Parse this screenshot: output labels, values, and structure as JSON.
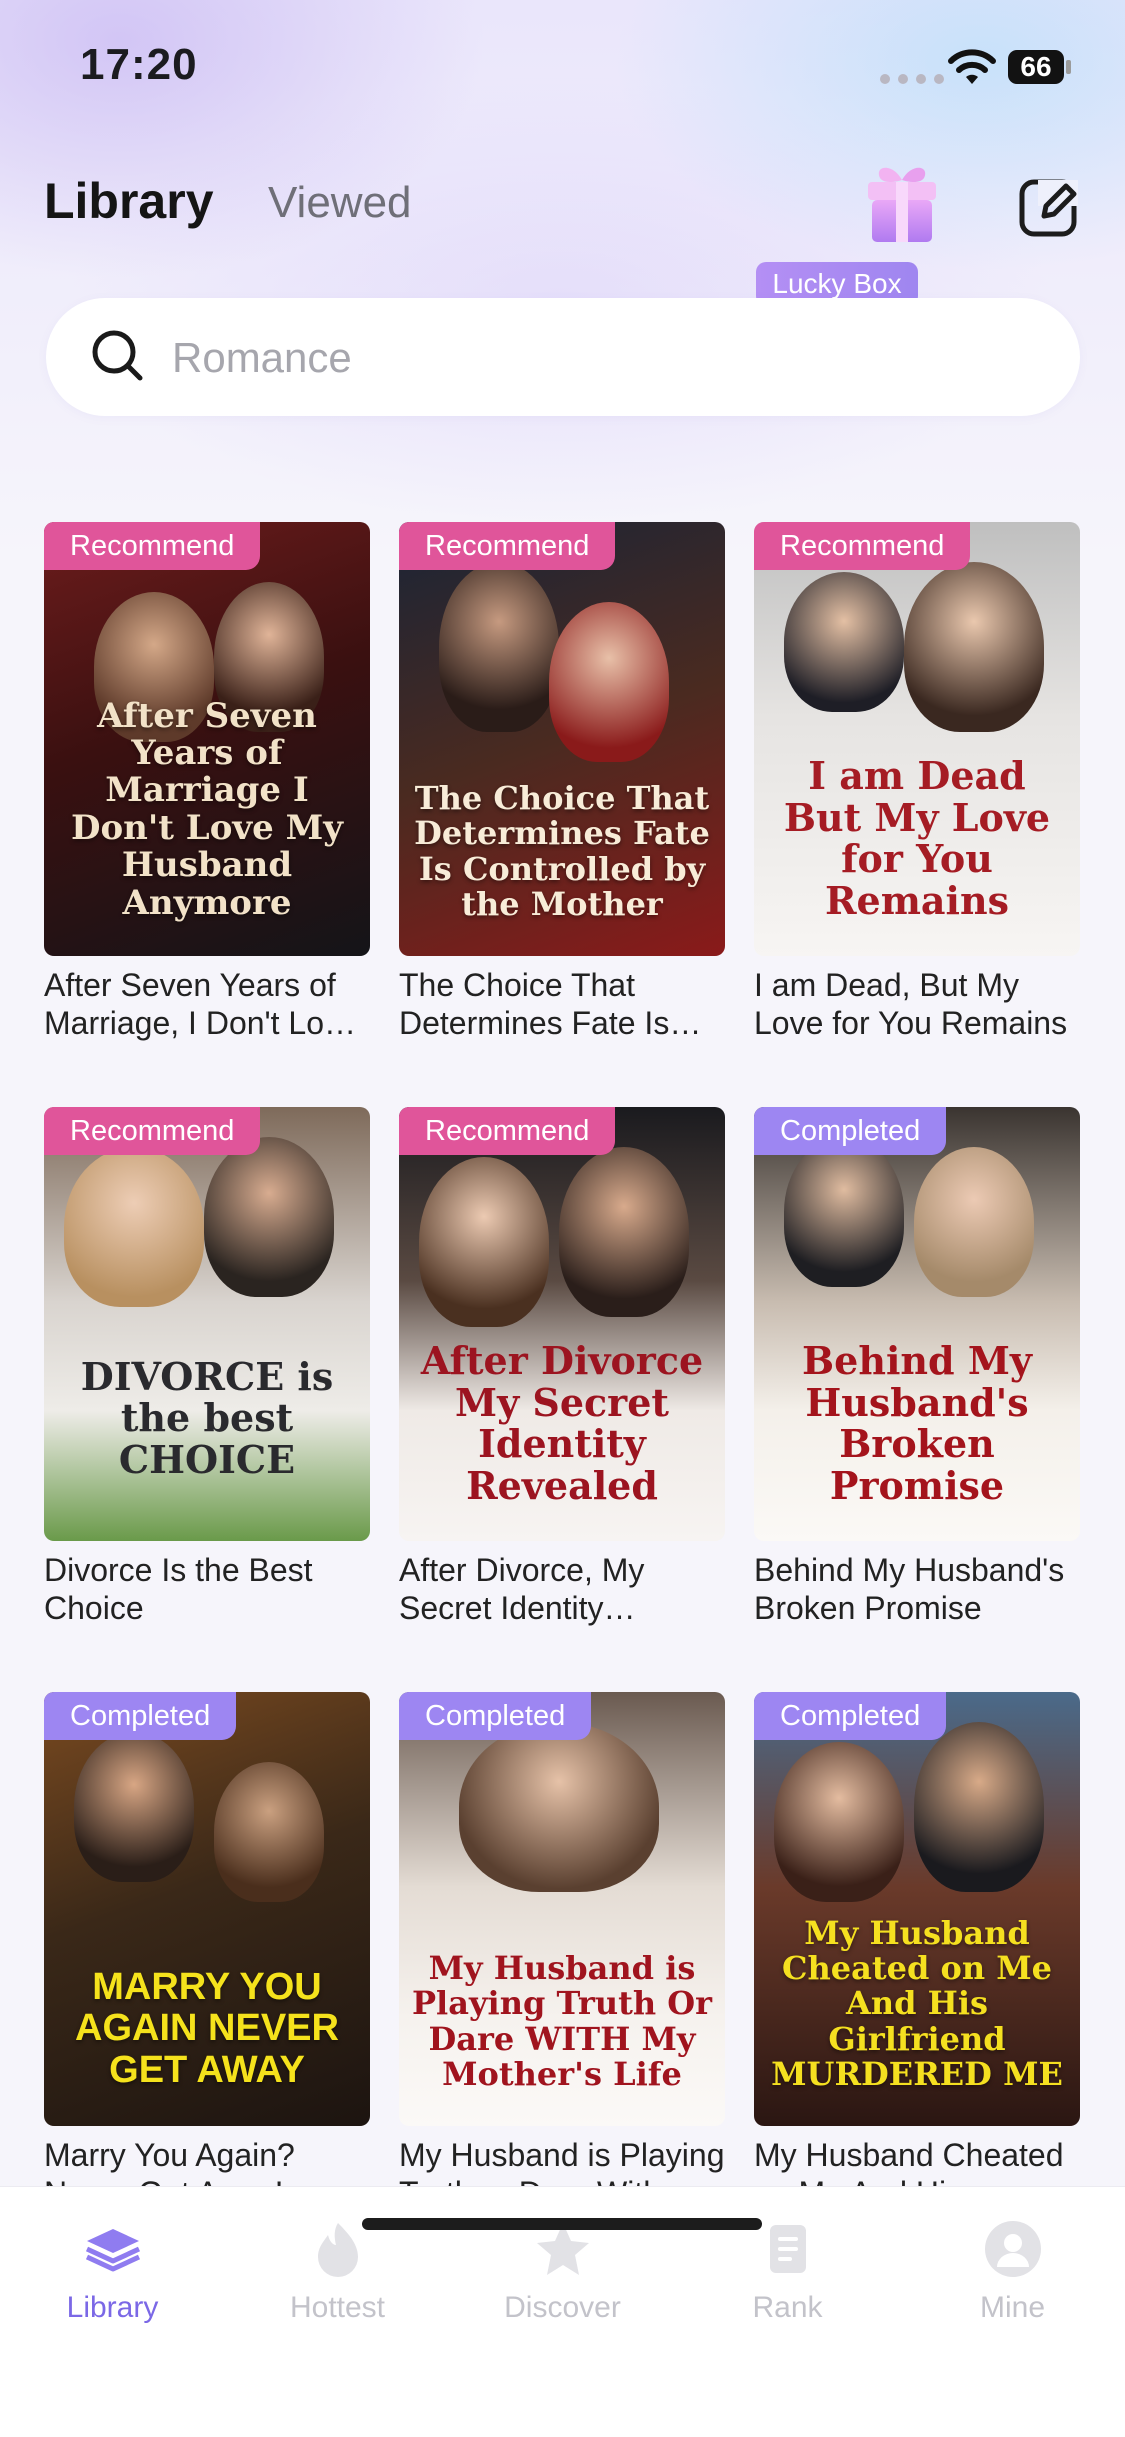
{
  "status_bar": {
    "time": "17:20",
    "battery": "66"
  },
  "header": {
    "tab_library": "Library",
    "tab_viewed": "Viewed",
    "lucky_box": "Lucky Box"
  },
  "search": {
    "placeholder": "Romance"
  },
  "books": [
    {
      "badge": "Recommend",
      "title": "After Seven Years of Marriage, I Don't Love My Husband Anymore",
      "cover_text": "After Seven Years of Marriage I Don't Love My Husband Anymore"
    },
    {
      "badge": "Recommend",
      "title": "The Choice That Determines Fate Is Controlled by the Mother",
      "cover_text": "The Choice That Determines Fate Is Controlled by the Mother"
    },
    {
      "badge": "Recommend",
      "title": "I am Dead, But My Love for You Remains",
      "cover_text": "I am Dead But My Love for You Remains"
    },
    {
      "badge": "Recommend",
      "title": "Divorce Is the Best Choice",
      "cover_text": "DIVORCE is the best CHOICE"
    },
    {
      "badge": "Recommend",
      "title": "After Divorce, My Secret Identity Revealed",
      "cover_text": "After Divorce My Secret Identity Revealed"
    },
    {
      "badge": "Completed",
      "title": "Behind My Husband's Broken Promise",
      "cover_text": "Behind My Husband's Broken Promise"
    },
    {
      "badge": "Completed",
      "title": "Marry You Again? Never Get Away!",
      "cover_text": "MARRY YOU AGAIN NEVER GET AWAY"
    },
    {
      "badge": "Completed",
      "title": "My Husband is Playing Truth or Dare With My Mother's Life",
      "cover_text": "My Husband is Playing Truth Or Dare WITH My Mother's Life"
    },
    {
      "badge": "Completed",
      "title": "My Husband Cheated on Me And His Girlfriend Murdered Me",
      "cover_text": "My Husband Cheated on Me And His Girlfriend MURDERED ME"
    }
  ],
  "bottom_nav": [
    {
      "label": "Library",
      "icon": "layers-icon",
      "active": true
    },
    {
      "label": "Hottest",
      "icon": "flame-icon",
      "active": false
    },
    {
      "label": "Discover",
      "icon": "star-icon",
      "active": false
    },
    {
      "label": "Rank",
      "icon": "rank-icon",
      "active": false
    },
    {
      "label": "Mine",
      "icon": "user-icon",
      "active": false
    }
  ],
  "colors": {
    "recommend": "#e0559a",
    "completed": "#9d86f2",
    "accent": "#7b68e6"
  }
}
